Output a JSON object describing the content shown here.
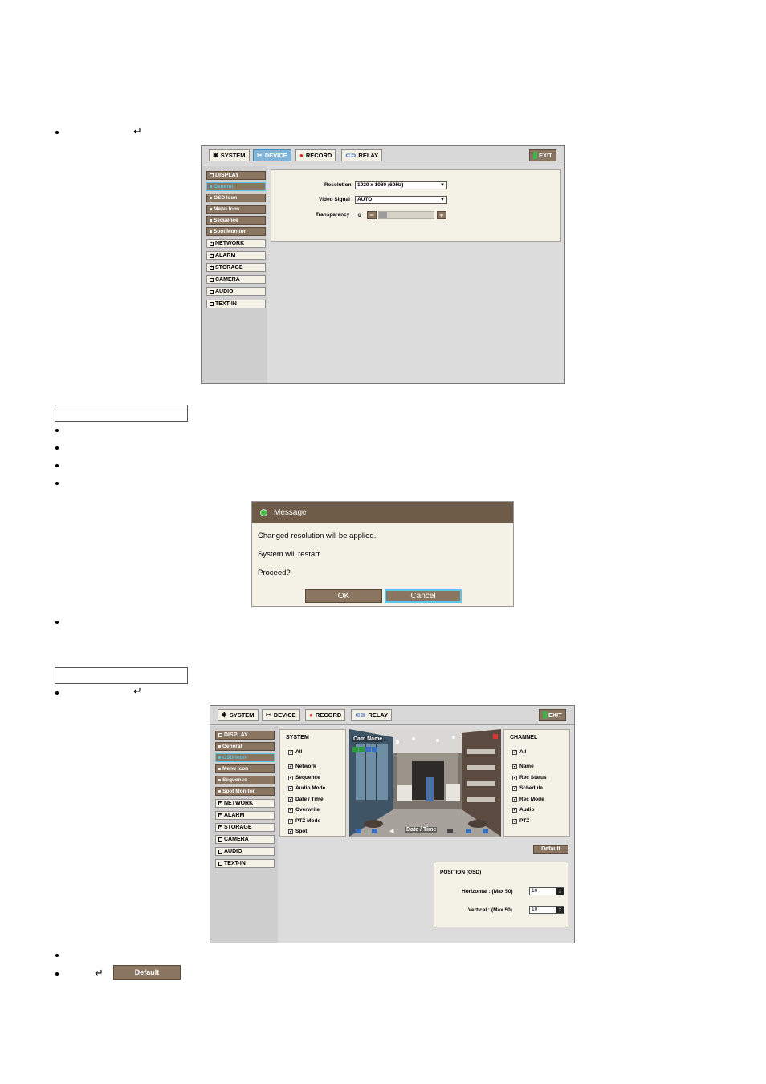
{
  "toolbar": {
    "system": "SYSTEM",
    "device": "DEVICE",
    "record": "RECORD",
    "relay": "RELAY",
    "exit": "EXIT"
  },
  "sidebar": {
    "display": "DISPLAY",
    "general": "General",
    "osd_icon": "OSD Icon",
    "menu_icon": "Menu Icon",
    "sequence": "Sequence",
    "spot_monitor": "Spot Monitor",
    "network": "NETWORK",
    "alarm": "ALARM",
    "storage": "STORAGE",
    "camera": "CAMERA",
    "audio": "AUDIO",
    "text_in": "TEXT-IN"
  },
  "general_panel": {
    "resolution_label": "Resolution",
    "resolution_value": "1920 x 1080 (60Hz)",
    "video_signal_label": "Video Signal",
    "video_signal_value": "AUTO",
    "transparency_label": "Transparency",
    "transparency_value": "0",
    "transparency_level": 0
  },
  "message": {
    "title": "Message",
    "line1": "Changed resolution will be applied.",
    "line2": "System will restart.",
    "line3": "Proceed?",
    "ok": "OK",
    "cancel": "Cancel"
  },
  "osd_panel": {
    "system_title": "SYSTEM",
    "system_items": [
      "All",
      "Network",
      "Sequence",
      "Audio Mode",
      "Date / Time",
      "Overwrite",
      "PTZ Mode",
      "Spot"
    ],
    "channel_title": "CHANNEL",
    "channel_items": [
      "All",
      "Name",
      "Rec Status",
      "Schedule",
      "Rec Mode",
      "Audio",
      "PTZ"
    ],
    "cam_name": "Cam Name",
    "date_time": "Date / Time",
    "default": "Default",
    "position_title": "POSITION (OSD)",
    "horizontal_label": "Horizontal : (Max 50)",
    "horizontal_value": "10",
    "vertical_label": "Vertical : (Max 50)",
    "vertical_value": "10"
  },
  "default_button": "Default"
}
